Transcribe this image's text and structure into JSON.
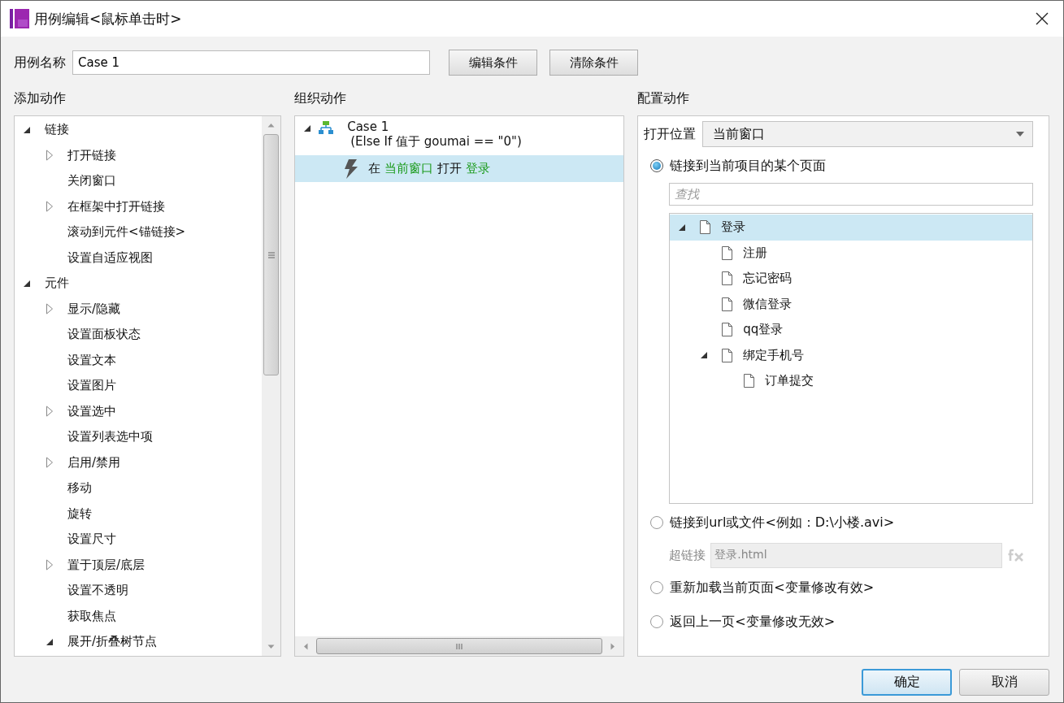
{
  "window": {
    "title": "用例编辑<鼠标单击时>"
  },
  "case_name": {
    "label": "用例名称",
    "value": "Case 1"
  },
  "top_buttons": [
    "编辑条件",
    "清除条件"
  ],
  "add_actions": {
    "heading": "添加动作",
    "items": [
      {
        "label": "链接",
        "expanded": true,
        "children": [
          {
            "label": "打开链接",
            "expanded": false
          },
          {
            "label": "关闭窗口"
          },
          {
            "label": "在框架中打开链接",
            "expanded": false
          },
          {
            "label": "滚动到元件<锚链接>"
          },
          {
            "label": "设置自适应视图"
          }
        ]
      },
      {
        "label": "元件",
        "expanded": true,
        "children": [
          {
            "label": "显示/隐藏",
            "expanded": false
          },
          {
            "label": "设置面板状态"
          },
          {
            "label": "设置文本"
          },
          {
            "label": "设置图片"
          },
          {
            "label": "设置选中",
            "expanded": false
          },
          {
            "label": "设置列表选中项"
          },
          {
            "label": "启用/禁用",
            "expanded": false
          },
          {
            "label": "移动"
          },
          {
            "label": "旋转"
          },
          {
            "label": "设置尺寸"
          },
          {
            "label": "置于顶层/底层",
            "expanded": false
          },
          {
            "label": "设置不透明"
          },
          {
            "label": "获取焦点"
          },
          {
            "label": "展开/折叠树节点",
            "expanded": true
          }
        ]
      }
    ]
  },
  "organize_actions": {
    "heading": "组织动作",
    "case": {
      "name": "Case 1",
      "condition": "(Else If 值于 goumai == \"0\")",
      "expanded": true
    },
    "actions": [
      {
        "selected": true,
        "parts": [
          {
            "kind": "plain",
            "text": "在"
          },
          {
            "kind": "value",
            "text": "当前窗口"
          },
          {
            "kind": "plain",
            "text": "打开"
          },
          {
            "kind": "value",
            "text": "登录"
          }
        ]
      }
    ]
  },
  "configure_action": {
    "heading": "配置动作",
    "open_in": {
      "label": "打开位置",
      "value": "当前窗口"
    },
    "options": [
      {
        "kind": "pages",
        "label": "链接到当前项目的某个页面",
        "selected": true,
        "search_placeholder": "查找",
        "pages": [
          {
            "label": "登录",
            "selected": true,
            "expanded": true,
            "children": [
              {
                "label": "注册",
                "selected": false
              },
              {
                "label": "忘记密码",
                "selected": false
              },
              {
                "label": "微信登录",
                "selected": false
              },
              {
                "label": "qq登录",
                "selected": false
              },
              {
                "label": "绑定手机号",
                "selected": false,
                "expanded": true,
                "children": [
                  {
                    "label": "订单提交",
                    "selected": false
                  }
                ]
              }
            ]
          }
        ]
      },
      {
        "kind": "url",
        "label": "链接到url或文件<例如：D:\\小楼.avi>",
        "selected": false,
        "field_label": "超链接",
        "field_value": "登录.html",
        "field_disabled": true
      },
      {
        "kind": "plain",
        "label": "重新加载当前页面<变量修改有效>",
        "selected": false
      },
      {
        "kind": "plain",
        "label": "返回上一页<变量修改无效>",
        "selected": false
      }
    ]
  },
  "dialog_buttons": [
    {
      "label": "确定",
      "default": true
    },
    {
      "label": "取消",
      "default": false
    }
  ]
}
